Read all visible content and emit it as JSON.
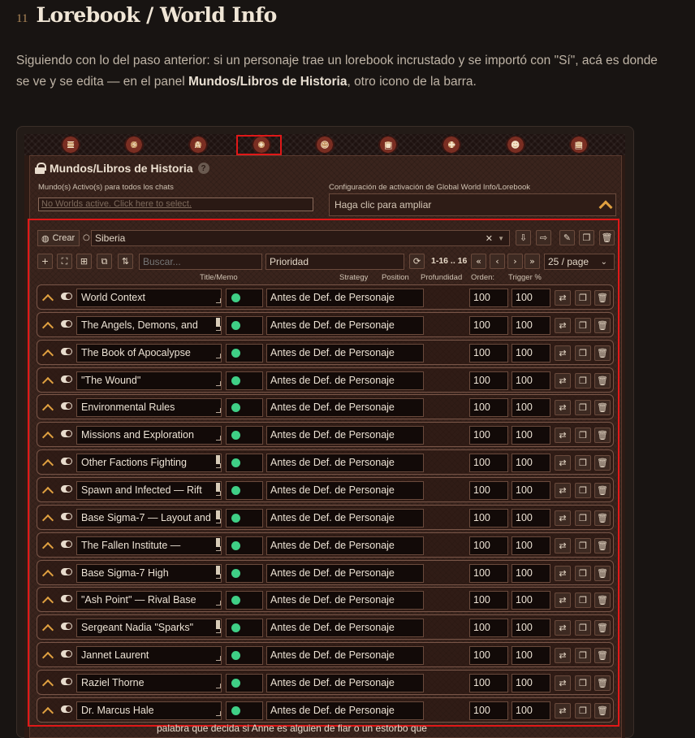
{
  "heading": {
    "number": "11",
    "title": "Lorebook / World Info"
  },
  "intro": {
    "part1": "Siguiendo con lo del paso anterior: si un personaje trae un lorebook incrustado y se importó con \"Sí\", acá es donde se ve y se edita — en el panel ",
    "bold": "Mundos/Libros de Historia",
    "part2": ", otro icono de la barra."
  },
  "topbar": {
    "icons": [
      "sliders-icon",
      "plug-icon",
      "font-icon",
      "book-icon",
      "user-icon",
      "image-icon",
      "puzzle-icon",
      "smile-icon",
      "id-card-icon"
    ]
  },
  "panel": {
    "title": "Mundos/Libros de Historia",
    "help": "?",
    "active_label": "Mundo(s) Activo(s) para todos los chats",
    "active_placeholder": "No Worlds active. Click here to select.",
    "activation_label": "Configuración de activación de Global World Info/Lorebook",
    "activation_value": "Haga clic para ampliar"
  },
  "editor": {
    "create_label": "Crear",
    "selected_book": "Siberia",
    "search_placeholder": "Buscar...",
    "sort_value": "Prioridad",
    "pagination": "1-16 .. 16",
    "page_size": "25 / page",
    "headers": {
      "title": "Title/Memo",
      "strategy": "Strategy",
      "position": "Position",
      "depth": "Profundidad",
      "order": "Orden:",
      "trigger": "Trigger %"
    }
  },
  "entries": [
    {
      "title": "World Context",
      "position": "Antes de Def. de Personaje",
      "order": "100",
      "trigger": "100",
      "scroll": false
    },
    {
      "title": "The Angels, Demons, and",
      "position": "Antes de Def. de Personaje",
      "order": "100",
      "trigger": "100",
      "scroll": true
    },
    {
      "title": "The Book of Apocalypse",
      "position": "Antes de Def. de Personaje",
      "order": "100",
      "trigger": "100",
      "scroll": false
    },
    {
      "title": "\"The Wound\"",
      "position": "Antes de Def. de Personaje",
      "order": "100",
      "trigger": "100",
      "scroll": false
    },
    {
      "title": "Environmental Rules",
      "position": "Antes de Def. de Personaje",
      "order": "100",
      "trigger": "100",
      "scroll": false
    },
    {
      "title": "Missions and Exploration",
      "position": "Antes de Def. de Personaje",
      "order": "100",
      "trigger": "100",
      "scroll": false
    },
    {
      "title": "Other Factions Fighting",
      "position": "Antes de Def. de Personaje",
      "order": "100",
      "trigger": "100",
      "scroll": true
    },
    {
      "title": "Spawn and Infected — Rift",
      "position": "Antes de Def. de Personaje",
      "order": "100",
      "trigger": "100",
      "scroll": true
    },
    {
      "title": "Base Sigma-7 — Layout and",
      "position": "Antes de Def. de Personaje",
      "order": "100",
      "trigger": "100",
      "scroll": true
    },
    {
      "title": "The Fallen Institute —",
      "position": "Antes de Def. de Personaje",
      "order": "100",
      "trigger": "100",
      "scroll": true
    },
    {
      "title": "Base Sigma-7 High",
      "position": "Antes de Def. de Personaje",
      "order": "100",
      "trigger": "100",
      "scroll": true
    },
    {
      "title": "\"Ash Point\" — Rival Base",
      "position": "Antes de Def. de Personaje",
      "order": "100",
      "trigger": "100",
      "scroll": false
    },
    {
      "title": "Sergeant Nadia \"Sparks\"",
      "position": "Antes de Def. de Personaje",
      "order": "100",
      "trigger": "100",
      "scroll": true
    },
    {
      "title": "Jannet Laurent",
      "position": "Antes de Def. de Personaje",
      "order": "100",
      "trigger": "100",
      "scroll": false
    },
    {
      "title": "Raziel Thorne",
      "position": "Antes de Def. de Personaje",
      "order": "100",
      "trigger": "100",
      "scroll": false
    },
    {
      "title": "Dr. Marcus Hale",
      "position": "Antes de Def. de Personaje",
      "order": "100",
      "trigger": "100",
      "scroll": false
    }
  ],
  "bottom_text": "palabra que decida si Anne es alguien de fiar o un estorbo que",
  "colors": {
    "highlight": "#e01818",
    "strategy_dot": "#3fcf86",
    "chevron": "#e0a040"
  }
}
